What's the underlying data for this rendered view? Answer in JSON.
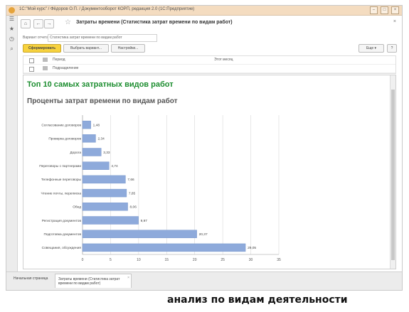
{
  "titlebar": {
    "title": "1С:\"Мой курс\" / Фёдоров О.П. / Документооборот КОРП, редакция 2.0 (1С:Предприятие)"
  },
  "form": {
    "title": "Затраты времени (Статистика затрат времени по видам работ)"
  },
  "variant": {
    "label": "Вариант отчета:",
    "value": "Статистика затрат времени по видам работ"
  },
  "toolbar": {
    "generate": "Сформировать",
    "choose_variant": "Выбрать вариант...",
    "settings": "Настройки...",
    "more": "Еще",
    "help": "?"
  },
  "settings": {
    "rows": [
      {
        "name": "Период",
        "value": "Этот месяц"
      },
      {
        "name": "Подразделение",
        "value": ""
      }
    ]
  },
  "report": {
    "title": "Топ 10 самых затратных видов работ",
    "chart_title": "Проценты затрат времени по видам работ"
  },
  "chart_data": {
    "type": "bar",
    "orientation": "horizontal",
    "categories": [
      "Согласование договоров",
      "Проверка договоров",
      "Дорога",
      "Переговоры с партнерами",
      "Телефонные переговоры",
      "Чтение почты, переписка",
      "Обед",
      "Регистрация документов",
      "Подготовка документов",
      "Совещания, обсуждения"
    ],
    "values": [
      1.48,
      2.34,
      3.33,
      4.74,
      7.66,
      7.85,
      8.06,
      9.97,
      20.37,
      29.05
    ],
    "value_labels": [
      "1,48",
      "2,34",
      "3,33",
      "4,74",
      "7,66",
      "7,85",
      "8,06",
      "9,97",
      "20,37",
      "29,05"
    ],
    "xlim": [
      0,
      35
    ],
    "x_ticks": [
      "0",
      "5",
      "10",
      "15",
      "20",
      "25",
      "30",
      "35"
    ],
    "grid": true,
    "bar_color": "#8eaadb"
  },
  "tabs": [
    {
      "label": "Начальная страница"
    },
    {
      "label": "Затраты времени (Статистика затрат времени по видам работ)"
    }
  ],
  "caption": "анализ по видам деятельности"
}
